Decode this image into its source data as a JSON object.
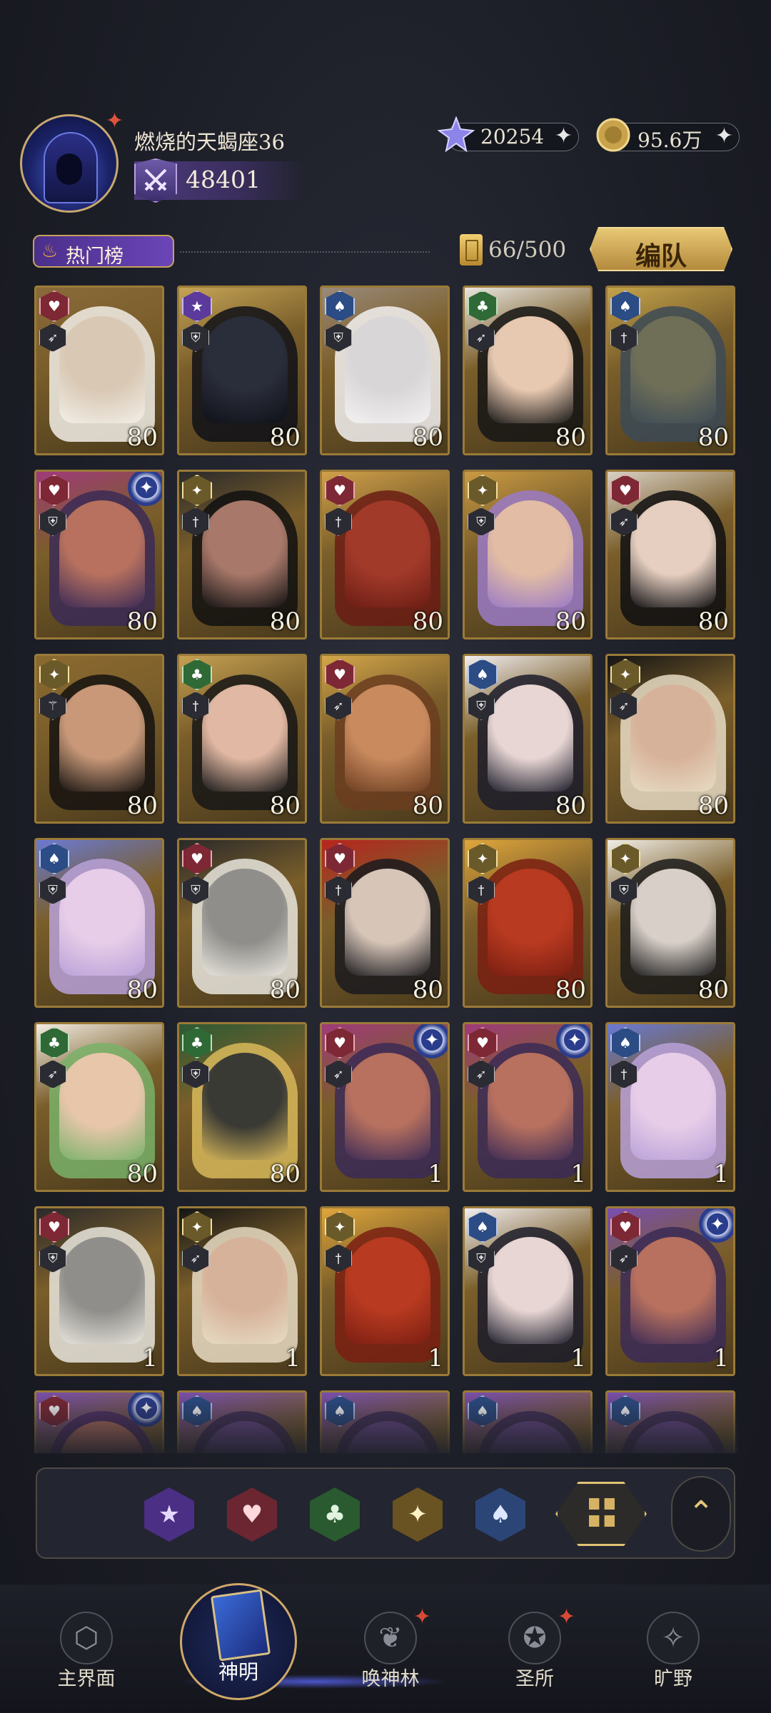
{
  "player": {
    "name": "燃烧的天蝎座36",
    "power": "48401"
  },
  "resources": {
    "crystal": "20254",
    "coin": "95.6万",
    "plus": "+"
  },
  "ranking": {
    "label": "热门榜"
  },
  "capacity": {
    "text": "66/500"
  },
  "team_button": {
    "label": "编队"
  },
  "cards": [
    {
      "suit": "heart",
      "weapon": "bow",
      "level": "80",
      "palette": [
        "#d9c8b4",
        "#f2efe8",
        "#8a6a3a"
      ]
    },
    {
      "suit": "star",
      "weapon": "shield",
      "level": "80",
      "palette": [
        "#2a2d3a",
        "#0f1118",
        "#c5a456"
      ]
    },
    {
      "suit": "spade",
      "weapon": "shield",
      "level": "80",
      "palette": [
        "#d9d6d8",
        "#f3f1f1",
        "#9a8a7a"
      ]
    },
    {
      "suit": "club",
      "weapon": "bow",
      "level": "80",
      "palette": [
        "#e7c8b0",
        "#151515",
        "#e9e6e0"
      ]
    },
    {
      "suit": "spade",
      "weapon": "dagger",
      "level": "80",
      "palette": [
        "#6f6f58",
        "#3c4a56",
        "#c3a24c"
      ]
    },
    {
      "suit": "heart",
      "weapon": "shield",
      "level": "80",
      "palette": [
        "#b8715e",
        "#3b2a56",
        "#a03a7a"
      ],
      "awake": true
    },
    {
      "suit": "diamond",
      "weapon": "dagger",
      "level": "80",
      "palette": [
        "#a8786a",
        "#111111",
        "#2a2a2a"
      ]
    },
    {
      "suit": "heart",
      "weapon": "dagger",
      "level": "80",
      "palette": [
        "#a23a2a",
        "#6b1c14",
        "#d0a04a"
      ]
    },
    {
      "suit": "diamond",
      "weapon": "shield",
      "level": "80",
      "palette": [
        "#e2bca4",
        "#9a7ac6",
        "#c99a44"
      ]
    },
    {
      "suit": "heart",
      "weapon": "bow",
      "level": "80",
      "palette": [
        "#e6cfc0",
        "#0f0f12",
        "#d8d0c4"
      ]
    },
    {
      "suit": "diamond",
      "weapon": "staff",
      "level": "80",
      "palette": [
        "#c89878",
        "#151210",
        "#8c6a30"
      ]
    },
    {
      "suit": "club",
      "weapon": "dagger",
      "level": "80",
      "palette": [
        "#e1b8a3",
        "#161616",
        "#c4a052"
      ]
    },
    {
      "suit": "heart",
      "weapon": "bow",
      "level": "80",
      "palette": [
        "#c98a5e",
        "#6b3d20",
        "#d4a64a"
      ]
    },
    {
      "suit": "spade",
      "weapon": "shield",
      "level": "80",
      "palette": [
        "#e8d6d4",
        "#1c1c2a",
        "#f1eef0"
      ]
    },
    {
      "suit": "diamond",
      "weapon": "bow",
      "level": "80",
      "palette": [
        "#d7b29a",
        "#e7dcc4",
        "#151515"
      ]
    },
    {
      "suit": "spade",
      "weapon": "shield",
      "level": "80",
      "palette": [
        "#e7cde8",
        "#b9a1d8",
        "#6a7ad4"
      ]
    },
    {
      "suit": "heart",
      "weapon": "shield",
      "level": "80",
      "palette": [
        "#8f8e8a",
        "#e9e6de",
        "#2a2a2a"
      ]
    },
    {
      "suit": "heart",
      "weapon": "dagger",
      "level": "80",
      "palette": [
        "#d7c5b8",
        "#1a1a1e",
        "#b8251e"
      ]
    },
    {
      "suit": "diamond",
      "weapon": "dagger",
      "level": "80",
      "palette": [
        "#b83a20",
        "#7a1e12",
        "#e0a63c"
      ]
    },
    {
      "suit": "diamond",
      "weapon": "shield",
      "level": "80",
      "palette": [
        "#d8cfc8",
        "#1b1b1b",
        "#f0ede6"
      ]
    },
    {
      "suit": "club",
      "weapon": "bow",
      "level": "80",
      "palette": [
        "#e7c6aa",
        "#7ab26a",
        "#f1ece2"
      ]
    },
    {
      "suit": "club",
      "weapon": "shield",
      "level": "80",
      "palette": [
        "#3a3a34",
        "#d8b85a",
        "#2c5a34"
      ]
    },
    {
      "suit": "heart",
      "weapon": "bow",
      "level": "1",
      "palette": [
        "#b8715e",
        "#3b2a56",
        "#a03a7a"
      ],
      "awake": true
    },
    {
      "suit": "heart",
      "weapon": "bow",
      "level": "1",
      "palette": [
        "#b8715e",
        "#3b2a56",
        "#a03a7a"
      ],
      "awake": true
    },
    {
      "suit": "spade",
      "weapon": "dagger",
      "level": "1",
      "palette": [
        "#e7cde8",
        "#b9a1d8",
        "#6a7ad4"
      ]
    },
    {
      "suit": "heart",
      "weapon": "shield",
      "level": "1",
      "palette": [
        "#8f8e8a",
        "#e9e6de",
        "#2a2a2a"
      ]
    },
    {
      "suit": "diamond",
      "weapon": "bow",
      "level": "1",
      "palette": [
        "#d7b29a",
        "#e7dcc4",
        "#151515"
      ]
    },
    {
      "suit": "diamond",
      "weapon": "dagger",
      "level": "1",
      "palette": [
        "#b83a20",
        "#7a1e12",
        "#e0a63c"
      ]
    },
    {
      "suit": "spade",
      "weapon": "shield",
      "level": "1",
      "palette": [
        "#e8d6d4",
        "#1c1c2a",
        "#f1eef0"
      ]
    },
    {
      "suit": "heart",
      "weapon": "bow",
      "level": "1",
      "palette": [
        "#b8715e",
        "#3b2a56",
        "#7a4fb0"
      ],
      "awake": true
    },
    {
      "suit": "heart",
      "weapon": "",
      "level": "",
      "palette": [
        "#b8715e",
        "#4b2a66",
        "#7a4fb0"
      ],
      "awake": true
    },
    {
      "suit": "spade",
      "weapon": "",
      "level": "",
      "palette": [
        "#6a4a8a",
        "#3b2a56",
        "#7a4fb0"
      ]
    },
    {
      "suit": "spade",
      "weapon": "",
      "level": "",
      "palette": [
        "#6a4a8a",
        "#3b2a56",
        "#7a4fb0"
      ]
    },
    {
      "suit": "spade",
      "weapon": "",
      "level": "",
      "palette": [
        "#6a4a8a",
        "#3b2a56",
        "#7a4fb0"
      ]
    },
    {
      "suit": "spade",
      "weapon": "",
      "level": "",
      "palette": [
        "#6a4a8a",
        "#3b2a56",
        "#7a4fb0"
      ]
    }
  ],
  "filters": [
    "star",
    "heart",
    "club",
    "diamond",
    "spade",
    "all"
  ],
  "nav": {
    "items": [
      {
        "label": "主界面",
        "icon": "home-icon"
      },
      {
        "label": "神明",
        "icon": "book-icon",
        "active": true
      },
      {
        "label": "唤神林",
        "icon": "tree-icon",
        "badge": true
      },
      {
        "label": "圣所",
        "icon": "sanctuary-icon",
        "badge": true
      },
      {
        "label": "旷野",
        "icon": "compass-icon"
      }
    ]
  },
  "colors": {
    "accent_gold": "#c6a25c",
    "badge_red": "#e0533c"
  }
}
